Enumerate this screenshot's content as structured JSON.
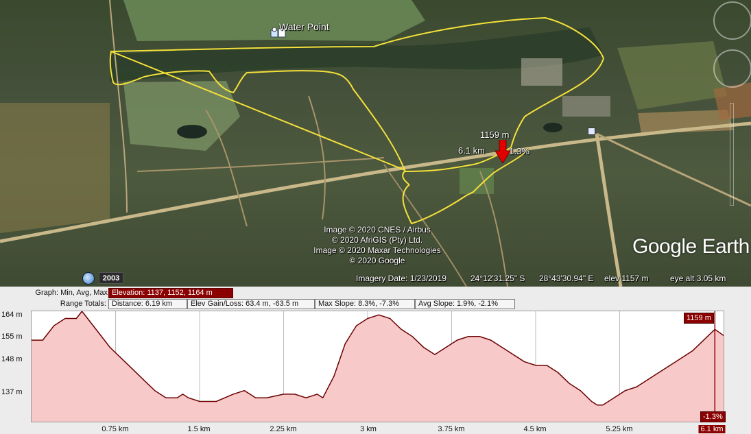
{
  "map": {
    "placemark_label": "Water Point",
    "cursor_elevation": "1159 m",
    "cursor_distance": "6.1 km",
    "cursor_slope": "-1.3%",
    "copyright_lines": [
      "Image © 2020 CNES / Airbus",
      "© 2020 AfriGIS (Pty) Ltd.",
      "Image © 2020 Maxar Technologies",
      "© 2020 Google"
    ],
    "logo_text": "Google Earth",
    "historical_year": "2003",
    "status": {
      "imagery_date": "Imagery Date: 1/23/2019",
      "latitude": "24°12'31.25\" S",
      "longitude": "28°43'30.94\" E",
      "elevation": "elev  1157 m",
      "eye_alt": "eye alt  3.05 km"
    },
    "path_color": "#f5e13a",
    "marker_color": "#e00000"
  },
  "profile": {
    "graph_label": "Graph: Min, Avg, Max",
    "graph_value": "Elevation: 1137, 1152, 1164 m",
    "range_label": "Range Totals:",
    "range_distance": "Distance: 6.19 km",
    "range_gain": "Elev Gain/Loss: 63.4 m, -63.5 m",
    "range_max_slope": "Max Slope: 8.3%, -7.3%",
    "range_avg_slope": "Avg Slope: 1.9%, -2.1%",
    "y_ticks": [
      "164 m",
      "155 m",
      "148 m",
      "137 m"
    ],
    "x_ticks": [
      "0.75 km",
      "1.5 km",
      "2.25 km",
      "3 km",
      "3.75 km",
      "4.5 km",
      "5.25 km",
      "6.1 km"
    ],
    "cursor_elev_label": "1159 m",
    "cursor_slope_label": "-1.3%"
  },
  "chart_data": {
    "type": "area",
    "xlabel": "",
    "ylabel": "",
    "ylim": [
      1133,
      1164
    ],
    "xlim": [
      0,
      6.19
    ],
    "fill_color": "#f7c9c9",
    "line_color": "#6b0000",
    "x": [
      0,
      0.1,
      0.2,
      0.3,
      0.4,
      0.45,
      0.5,
      0.6,
      0.7,
      0.8,
      0.9,
      1.0,
      1.1,
      1.2,
      1.3,
      1.35,
      1.4,
      1.5,
      1.6,
      1.65,
      1.8,
      1.9,
      1.95,
      2.0,
      2.1,
      2.25,
      2.35,
      2.45,
      2.55,
      2.6,
      2.7,
      2.8,
      2.9,
      3.0,
      3.1,
      3.2,
      3.3,
      3.4,
      3.5,
      3.6,
      3.7,
      3.8,
      3.9,
      4.0,
      4.1,
      4.2,
      4.3,
      4.4,
      4.5,
      4.6,
      4.7,
      4.8,
      4.9,
      5.0,
      5.05,
      5.1,
      5.2,
      5.3,
      5.4,
      5.5,
      5.6,
      5.7,
      5.8,
      5.9,
      6.0,
      6.1,
      6.19
    ],
    "series": [
      {
        "values": [
          1156,
          1156,
          1160,
          1162,
          1162,
          1164,
          1162,
          1158,
          1154,
          1151,
          1148,
          1145,
          1142,
          1140,
          1140,
          1141,
          1140,
          1139,
          1139,
          1139,
          1141,
          1142,
          1141,
          1140,
          1140,
          1141,
          1141,
          1140,
          1141,
          1140,
          1146,
          1155,
          1160,
          1162,
          1163,
          1162,
          1159,
          1157,
          1154,
          1152,
          1154,
          1156,
          1157,
          1157,
          1156,
          1154,
          1152,
          1150,
          1149,
          1149,
          1147,
          1144,
          1142,
          1139,
          1138,
          1138,
          1140,
          1142,
          1143,
          1145,
          1147,
          1149,
          1151,
          1153,
          1156,
          1159,
          1157
        ]
      }
    ]
  }
}
